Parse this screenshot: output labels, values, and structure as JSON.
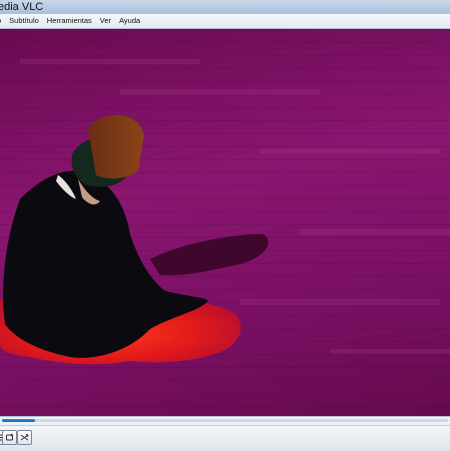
{
  "window": {
    "title": "edia VLC"
  },
  "menubar": {
    "items": [
      "o",
      "Subtítulo",
      "Herramientas",
      "Ver",
      "Ayuda"
    ]
  },
  "playback": {
    "progress": 0.075
  },
  "controls": {
    "buttons": [
      "extended-settings-icon",
      "loop-icon",
      "shuffle-icon"
    ]
  },
  "colors": {
    "video_magenta": "#7a1064",
    "seek_fill": "#1e78d0",
    "rug_red": "#e21a1a"
  }
}
